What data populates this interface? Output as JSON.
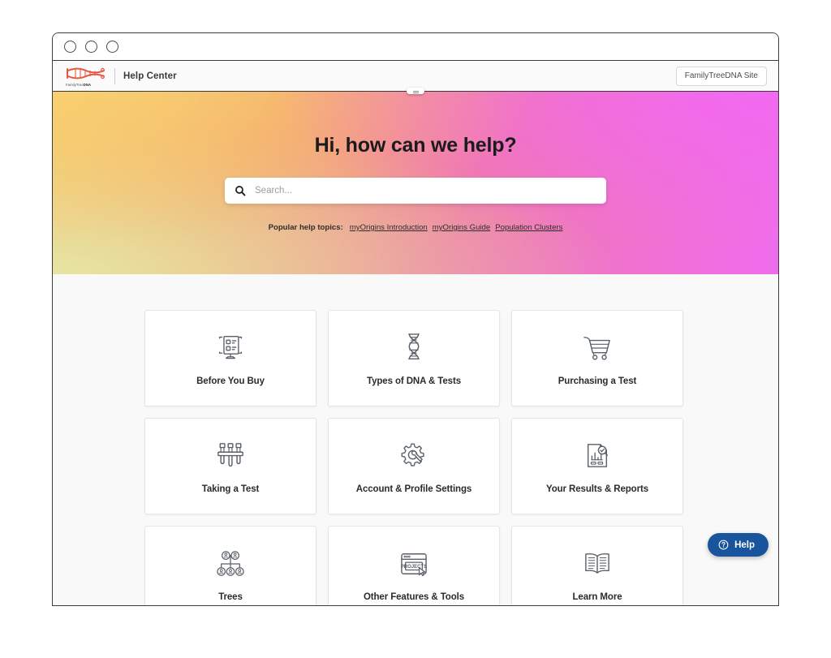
{
  "window": {
    "traffic_lights": [
      "close",
      "minimize",
      "maximize"
    ]
  },
  "header": {
    "logo_name": "familytreedna-logo",
    "logo_text_light": "FamilyTree",
    "logo_text_bold": "DNA",
    "title": "Help Center",
    "site_button_label": "FamilyTreeDNA Site"
  },
  "hero": {
    "heading": "Hi, how can we help?",
    "search": {
      "placeholder": "Search...",
      "value": "",
      "icon": "search-icon"
    },
    "topics_label": "Popular help topics:",
    "topics": [
      {
        "label": "myOrigins Introduction"
      },
      {
        "label": "myOrigins Guide"
      },
      {
        "label": "Population Clusters"
      }
    ],
    "gradient": {
      "top_left": "#f3cd72",
      "mid": "#ef7aa8",
      "top_right": "#ef6cef",
      "bottom_left": "#e6e5a3"
    }
  },
  "categories": [
    {
      "label": "Before You Buy",
      "icon": "monitor-checklist-icon"
    },
    {
      "label": "Types of DNA & Tests",
      "icon": "dna-helix-icon"
    },
    {
      "label": "Purchasing a Test",
      "icon": "shopping-cart-icon"
    },
    {
      "label": "Taking a Test",
      "icon": "test-tubes-icon"
    },
    {
      "label": "Account & Profile Settings",
      "icon": "gear-wrench-icon"
    },
    {
      "label": "Your Results & Reports",
      "icon": "document-chart-search-icon"
    },
    {
      "label": "Trees",
      "icon": "family-tree-icon"
    },
    {
      "label": "Other Features & Tools",
      "icon": "browser-projects-icon"
    },
    {
      "label": "Learn More",
      "icon": "open-book-icon"
    }
  ],
  "help_widget": {
    "label": "Help",
    "icon": "question-circle-icon",
    "color": "#19559c"
  }
}
